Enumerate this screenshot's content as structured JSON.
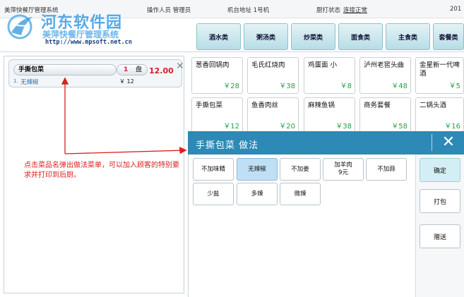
{
  "statusbar": {
    "app_title": "美萍快餐厅管理系统",
    "operator": "操作人员 管理员",
    "terminal": "机台地址 1号机",
    "printer_label": "厨打状态",
    "printer_status": "连接正常",
    "year_fragment": "201"
  },
  "watermark": {
    "main": "河东软件园",
    "sub": "美萍快餐厅管理系统",
    "url": "http://www.mpsoft.net.cn"
  },
  "category_tabs": [
    "酒水类",
    "粥汤类",
    "炒菜类",
    "面食类",
    "主食类",
    "套餐类"
  ],
  "order": {
    "item_name": "手撕包菜",
    "qty": "1",
    "unit": "盘",
    "price": "12.00",
    "close_glyph": "✕",
    "option_index": "1.",
    "option_name": "无辣椒",
    "option_price": "￥ 12"
  },
  "annotation": "点击菜品名弹出做法菜单，可以加入顾客的特别要求并打印到后厨。",
  "dishes": [
    {
      "name": "葱香回锅肉",
      "price": "￥28"
    },
    {
      "name": "毛氏红烧肉",
      "price": "￥38"
    },
    {
      "name": "鸡蛋面 小",
      "price": "￥8"
    },
    {
      "name": "泸州老窖头曲",
      "price": "￥48"
    },
    {
      "name": "金星新一代啤酒",
      "price": "￥5"
    },
    {
      "name": "手撕包菜",
      "price": "￥12"
    },
    {
      "name": "鱼香肉丝",
      "price": "￥20"
    },
    {
      "name": "麻辣鱼锅",
      "price": "￥38"
    },
    {
      "name": "商务套餐",
      "price": "￥58"
    },
    {
      "name": "二锅头酒",
      "price": "￥16"
    }
  ],
  "popup": {
    "title": "手撕包菜  做法",
    "close_glyph": "✕",
    "options": [
      {
        "label": "不加味精",
        "sub": "",
        "selected": false
      },
      {
        "label": "无辣椒",
        "sub": "",
        "selected": true
      },
      {
        "label": "不加姜",
        "sub": "",
        "selected": false
      },
      {
        "label": "加羊肉",
        "sub": "9元",
        "selected": false
      },
      {
        "label": "不加蒜",
        "sub": "",
        "selected": false
      },
      {
        "label": "少盐",
        "sub": "",
        "selected": false
      },
      {
        "label": "多辣",
        "sub": "",
        "selected": false
      },
      {
        "label": "微辣",
        "sub": "",
        "selected": false
      }
    ],
    "actions": {
      "confirm": "确定",
      "pack": "打包",
      "gift": "赠送"
    }
  },
  "colors": {
    "popup_header": "#2d89b6",
    "price_red": "#d2202a",
    "dish_price_green": "#23a14a",
    "selected_option": "#bfe0f4",
    "annotation_red": "#d92020"
  }
}
